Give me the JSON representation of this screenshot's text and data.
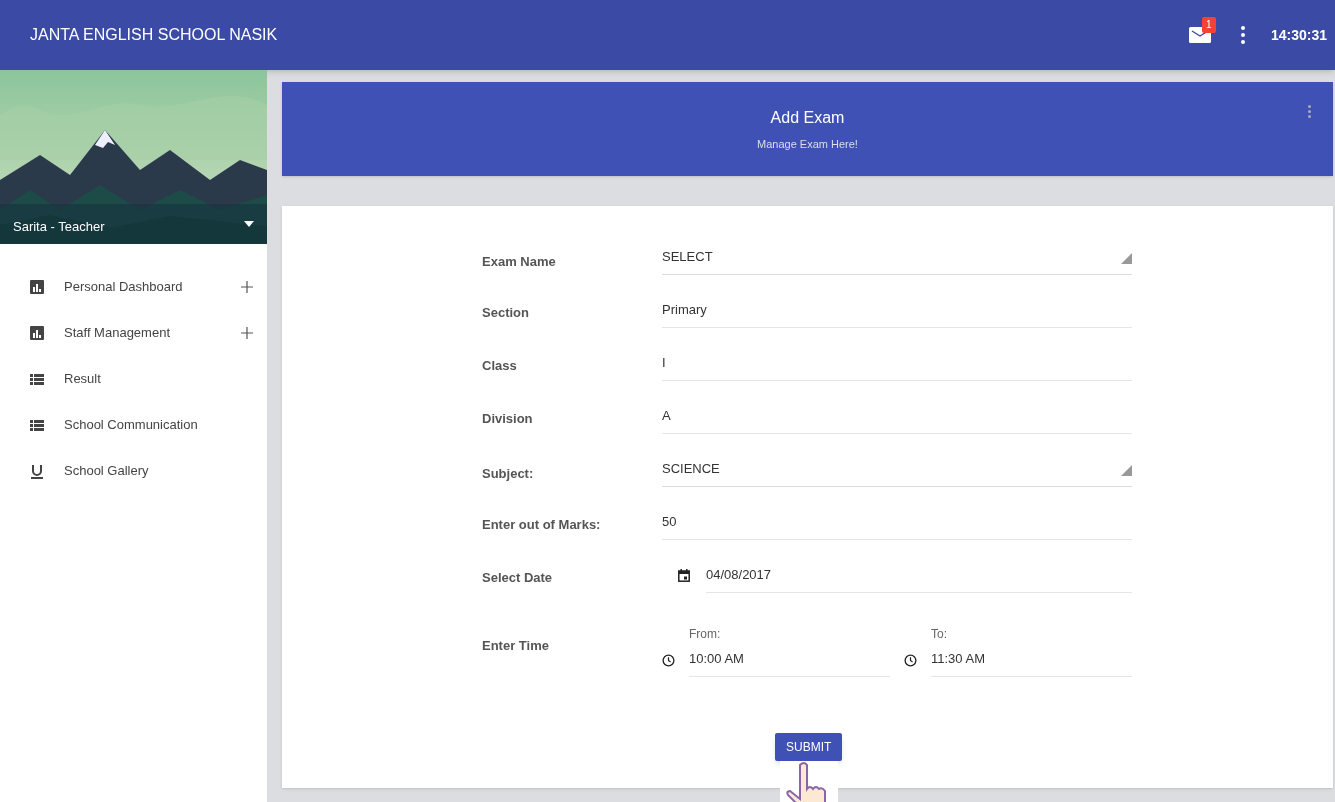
{
  "header": {
    "title": "JANTA ENGLISH SCHOOL NASIK",
    "mail_badge": "1",
    "clock": "14:30:31"
  },
  "profile": {
    "name": "Sarita - Teacher"
  },
  "sidebar": {
    "items": [
      {
        "label": "Personal Dashboard",
        "kind": "chart",
        "expandable": true
      },
      {
        "label": "Staff Management",
        "kind": "chart",
        "expandable": true
      },
      {
        "label": "Result",
        "kind": "list",
        "expandable": false
      },
      {
        "label": "School Communication",
        "kind": "list",
        "expandable": false
      },
      {
        "label": "School Gallery",
        "kind": "underline",
        "expandable": false
      }
    ]
  },
  "banner": {
    "title": "Add Exam",
    "subtitle": "Manage Exam Here!"
  },
  "form": {
    "fields": [
      {
        "kind": "select",
        "label": "Exam Name",
        "value": "SELECT"
      },
      {
        "kind": "text",
        "label": "Section",
        "value": "Primary"
      },
      {
        "kind": "text",
        "label": "Class",
        "value": "I"
      },
      {
        "kind": "text",
        "label": "Division",
        "value": "A"
      },
      {
        "kind": "select",
        "label": "Subject:",
        "value": "SCIENCE"
      },
      {
        "kind": "text",
        "label": "Enter out of Marks:",
        "value": "50"
      },
      {
        "kind": "date",
        "label": "Select Date",
        "value": "04/08/2017"
      },
      {
        "kind": "time_range",
        "label": "Enter Time",
        "from_label": "From:",
        "from_value": "10:00 AM",
        "to_label": "To:",
        "to_value": "11:30 AM"
      }
    ],
    "submit": "SUBMIT"
  }
}
